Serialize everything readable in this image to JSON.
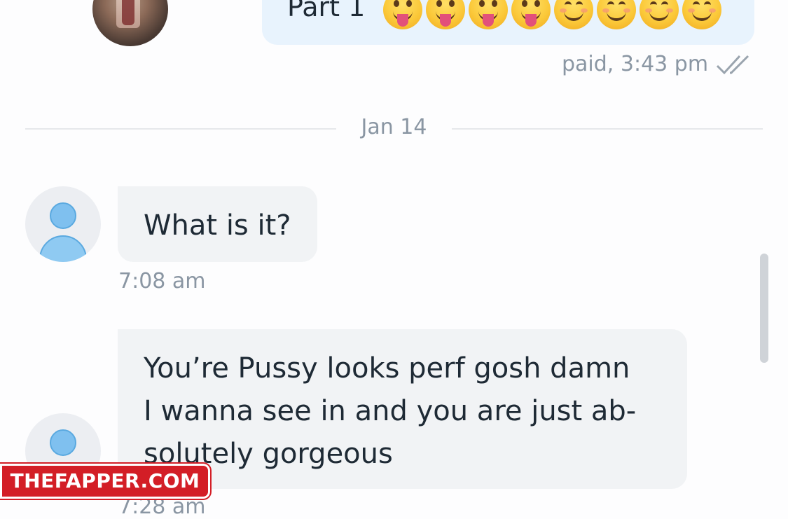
{
  "outgoing": {
    "text": "Part 1",
    "emojis": [
      "tongue-out-face-icon",
      "tongue-out-face-icon",
      "tongue-out-face-icon",
      "tongue-out-face-icon",
      "smiling-face-icon",
      "smiling-face-icon",
      "smiling-face-icon",
      "smiling-face-icon"
    ],
    "status": "paid, 3:43 pm",
    "read_icon": "double-check-icon"
  },
  "separator": {
    "date": "Jan 14"
  },
  "incoming": [
    {
      "text": "What is it?",
      "time": "7:08 am"
    },
    {
      "text": "You’re Pussy looks perf gosh damn I wanna see in and you are just ab-solutely gorgeous",
      "line1": "You’re Pussy looks perf gosh damn",
      "line2": "I wanna see in and you are just ab-",
      "line3": "solutely gorgeous",
      "time": "7:28 am"
    }
  ],
  "watermark": {
    "text": "THEFAPPER.COM"
  },
  "colors": {
    "outgoing_bubble": "#e8f3fd",
    "incoming_bubble": "#f1f3f5",
    "meta_text": "#8a96a3",
    "avatar_accent": "#7fc0ef",
    "watermark_bg": "#d31e26"
  }
}
